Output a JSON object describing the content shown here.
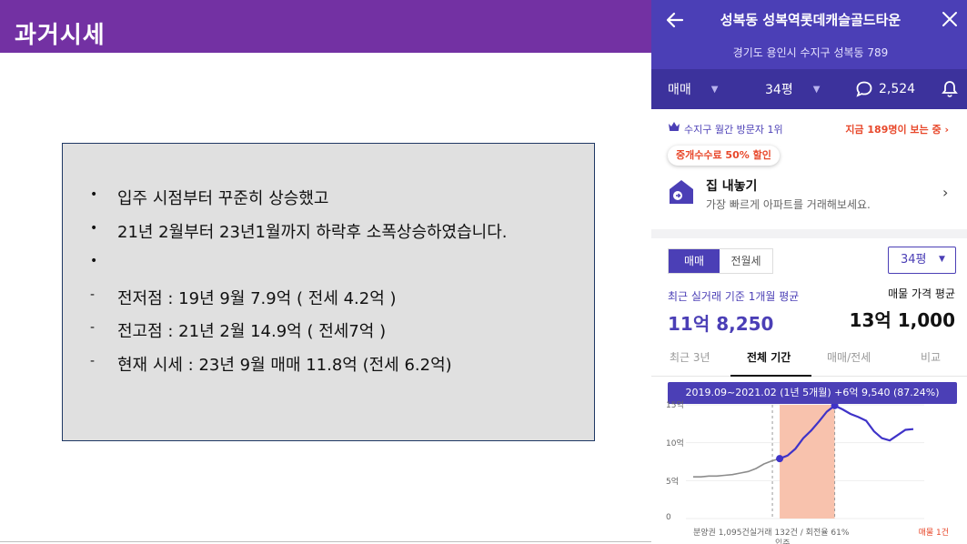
{
  "slide": {
    "title": "과거시세",
    "notes": [
      {
        "marker": "•",
        "text": "입주 시점부터 꾸준히 상승했고"
      },
      {
        "marker": "•",
        "text": "21년 2월부터 23년1월까지 하락후 소폭상승하였습니다."
      },
      {
        "marker": "•",
        "text": ""
      },
      {
        "marker": "-",
        "text": "전저점 : 19년 9월 7.9억 ( 전세 4.2억 )"
      },
      {
        "marker": "-",
        "text": "전고점 : 21년 2월 14.9억 ( 전세7억 )"
      },
      {
        "marker": "-",
        "text": "현재 시세 : 23년 9월 매매 11.8억 (전세 6.2억)"
      }
    ]
  },
  "app": {
    "name": "성복동 성복역롯데캐슬골드타운",
    "address": "경기도 용인시 수지구 성복동 789",
    "filters": {
      "deal": "매매",
      "size": "34평",
      "comments": "2,524"
    },
    "visitor_rank": "수지구 월간 방문자 1위",
    "viewers_now": "지금 189명이 보는 중",
    "discount_badge": "중개수수료 50% 할인",
    "sell_title": "집 내놓기",
    "sell_sub": "가장 빠르게 아파트를 거래해보세요.",
    "trade_tabs": [
      "매매",
      "전월세"
    ],
    "size_select": "34평",
    "recent_avg_label": "최근 실거래 기준 1개월 평균",
    "recent_avg_value": "11억 8,250",
    "listing_avg_label": "매물 가격 평균",
    "listing_avg_value": "13억 1,000",
    "period_tabs": [
      "최근 3년",
      "전체 기간",
      "매매/전세",
      "비교"
    ],
    "active_period": "전체 기간",
    "tooltip": "2019.09~2021.02 (1년 5개월) +6억 9,540 (87.24%)",
    "footer_left": "분양권 1,095건실거래 132건 / 회전율 61%",
    "footer_right": "매물 1건",
    "footer_x": "입주",
    "accent": "#4b3fb6",
    "alert": "#e8482b"
  },
  "chart_data": {
    "type": "line",
    "yticks": [
      "15억",
      "10억",
      "5억",
      "0"
    ],
    "ylim": [
      0,
      15
    ],
    "highlight_range": [
      "2019.09",
      "2021.02"
    ],
    "series": [
      {
        "values": [
          5.5,
          5.5,
          5.6,
          5.6,
          5.7,
          5.8,
          6.0,
          6.2,
          6.6,
          7.2,
          7.6,
          7.9,
          8.3,
          9.2,
          10.6,
          11.6,
          12.8,
          14.1,
          14.9,
          14.4,
          13.8,
          13.4,
          12.9,
          11.5,
          10.6,
          10.3,
          11.0,
          11.7,
          11.8
        ]
      }
    ]
  }
}
